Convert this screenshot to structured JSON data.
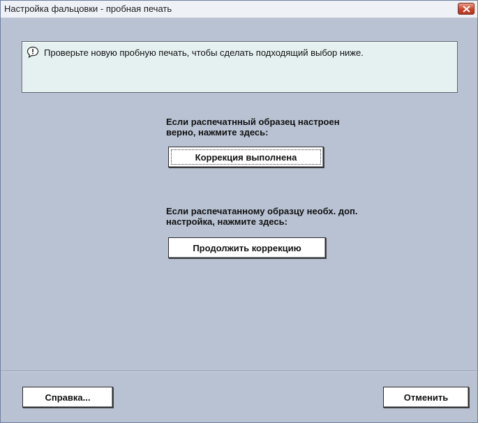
{
  "window": {
    "title": "Настройка фальцовки - пробная печать"
  },
  "message": {
    "text": "Проверьте новую пробную печать, чтобы сделать подходящий выбор ниже."
  },
  "option_done": {
    "label": "Если распечатнный образец настроен\nверно, нажмите здесь:",
    "button": "Коррекция выполнена"
  },
  "option_continue": {
    "label": "Если распечатанному образцу необх. доп.\nнастройка, нажмите здесь:",
    "button": "Продолжить коррекцию"
  },
  "footer": {
    "help_button": "Справка...",
    "cancel_button": "Отменить"
  }
}
